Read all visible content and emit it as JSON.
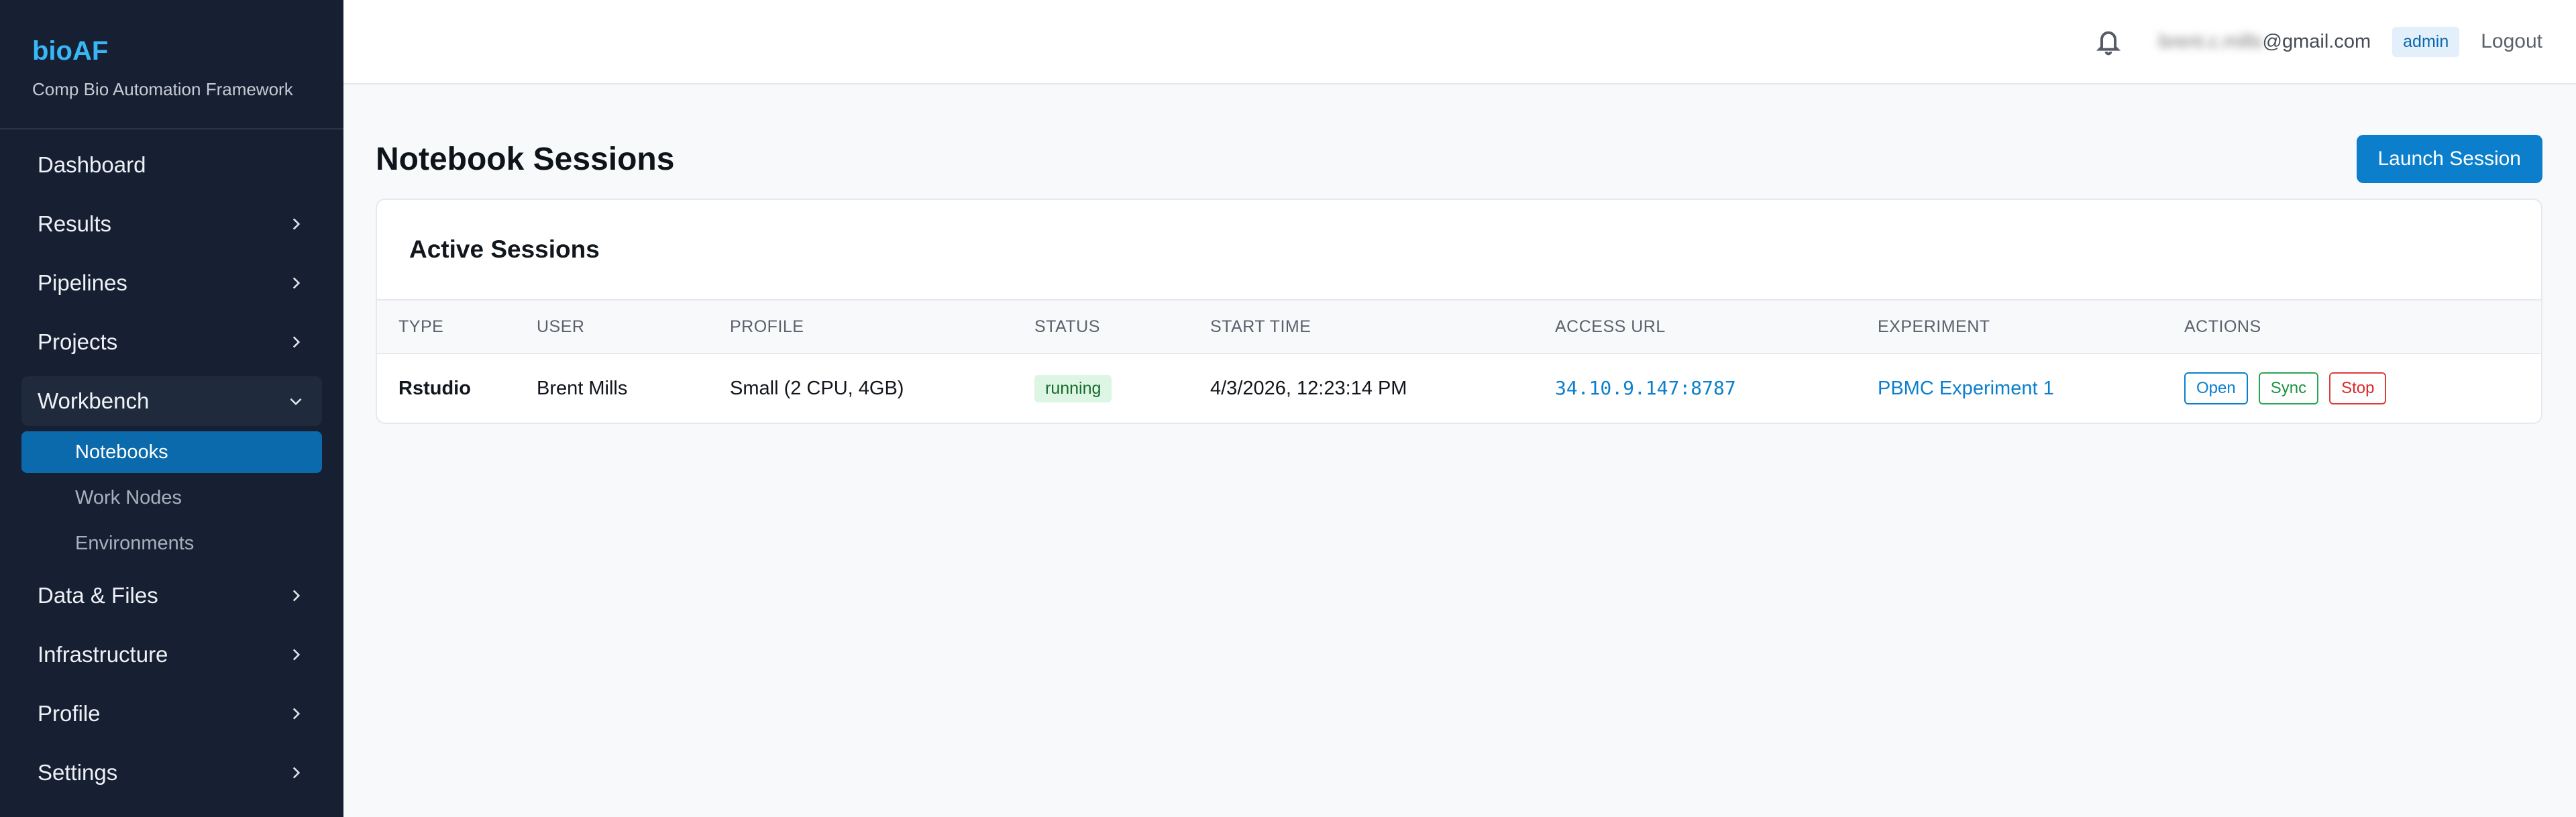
{
  "brand": {
    "title": "bioAF",
    "subtitle": "Comp Bio Automation Framework"
  },
  "sidebar": {
    "items": [
      {
        "label": "Dashboard",
        "chevron": "none"
      },
      {
        "label": "Results",
        "chevron": "right"
      },
      {
        "label": "Pipelines",
        "chevron": "right"
      },
      {
        "label": "Projects",
        "chevron": "right"
      },
      {
        "label": "Workbench",
        "chevron": "down",
        "children": [
          {
            "label": "Notebooks",
            "active": true
          },
          {
            "label": "Work Nodes"
          },
          {
            "label": "Environments"
          }
        ]
      },
      {
        "label": "Data & Files",
        "chevron": "right"
      },
      {
        "label": "Infrastructure",
        "chevron": "right"
      },
      {
        "label": "Profile",
        "chevron": "right"
      },
      {
        "label": "Settings",
        "chevron": "right"
      }
    ]
  },
  "topbar": {
    "icon": "bell-icon",
    "email_local_blurred": "brent.c.mills",
    "email_domain": "@gmail.com",
    "role": "admin",
    "logout": "Logout"
  },
  "page": {
    "title": "Notebook Sessions",
    "launch_label": "Launch Session"
  },
  "sessions": {
    "card_title": "Active Sessions",
    "columns": [
      "TYPE",
      "USER",
      "PROFILE",
      "STATUS",
      "START TIME",
      "ACCESS URL",
      "EXPERIMENT",
      "ACTIONS"
    ],
    "rows": [
      {
        "type": "Rstudio",
        "user": "Brent Mills",
        "profile": "Small (2 CPU, 4GB)",
        "status": "running",
        "start_time": "4/3/2026, 12:23:14 PM",
        "access_url": "34.10.9.147:8787",
        "experiment": "PBMC Experiment 1",
        "actions": {
          "open": "Open",
          "sync": "Sync",
          "stop": "Stop"
        }
      }
    ]
  },
  "colors": {
    "sidebar_bg": "#172032",
    "brand": "#38b6f5",
    "active_nav": "#0a6aab",
    "primary": "#0b7fcc",
    "running_bg": "#dcf6e3",
    "sync": "#2aa552",
    "stop": "#de3b3b"
  }
}
